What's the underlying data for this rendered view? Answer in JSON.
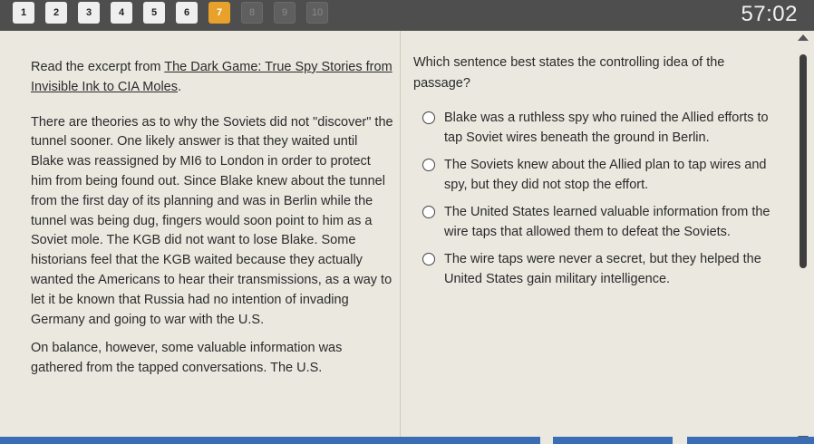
{
  "nav": {
    "questions": [
      {
        "label": "1",
        "state": "answered"
      },
      {
        "label": "2",
        "state": "answered"
      },
      {
        "label": "3",
        "state": "answered"
      },
      {
        "label": "4",
        "state": "answered"
      },
      {
        "label": "5",
        "state": "answered"
      },
      {
        "label": "6",
        "state": "answered"
      },
      {
        "label": "7",
        "state": "current"
      },
      {
        "label": "8",
        "state": "pending"
      },
      {
        "label": "9",
        "state": "pending"
      },
      {
        "label": "10",
        "state": "pending"
      }
    ]
  },
  "timer": "57:02",
  "passage": {
    "intro_prefix": "Read the excerpt from ",
    "source_title": "The Dark Game: True Spy Stories from Invisible Ink to CIA Moles",
    "intro_suffix": ".",
    "paragraphs": [
      "There are theories as to why the Soviets did not \"discover\" the tunnel sooner. One likely answer is that they waited until Blake was reassigned by MI6 to London in order to protect him from being found out. Since Blake knew about the tunnel from the first day of its planning and was in Berlin while the tunnel was being dug, fingers would soon point to him as a Soviet mole. The KGB did not want to lose Blake. Some historians feel that the KGB waited because they actually wanted the Americans to hear their transmissions, as a way to let it be known that Russia had no intention of invading Germany and going to war with the U.S.",
      "On balance, however, some valuable information was gathered from the tapped conversations. The U.S."
    ]
  },
  "question": {
    "text": "Which sentence best states the controlling idea of the passage?",
    "options": [
      "Blake was a ruthless spy who ruined the Allied efforts to tap Soviet wires beneath the ground in Berlin.",
      "The Soviets knew about the Allied plan to tap wires and spy, but they did not stop the effort.",
      "The United States learned valuable information from the wire taps that allowed them to defeat the Soviets.",
      "The wire taps were never a secret, but they helped the United States gain military intelligence."
    ]
  }
}
